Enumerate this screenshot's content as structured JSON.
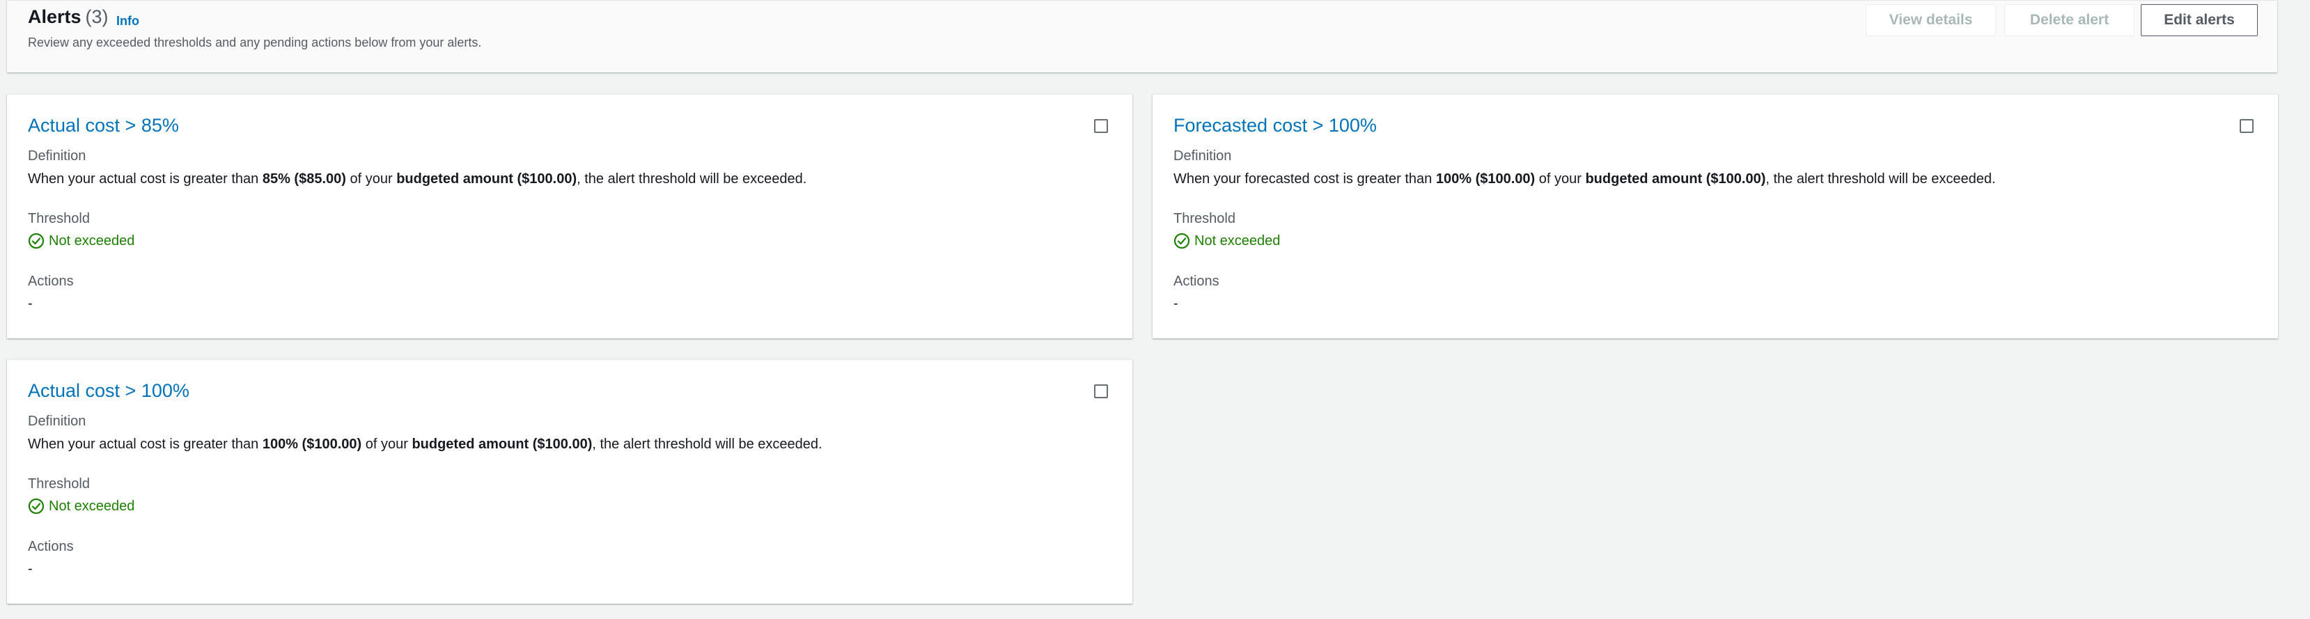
{
  "header": {
    "title": "Alerts",
    "count": "(3)",
    "info": "Info",
    "description": "Review any exceeded thresholds and any pending actions below from your alerts.",
    "buttons": {
      "view_details": "View details",
      "delete_alert": "Delete alert",
      "edit_alerts": "Edit alerts"
    }
  },
  "labels": {
    "definition": "Definition",
    "threshold": "Threshold",
    "actions": "Actions"
  },
  "alerts": [
    {
      "title": "Actual cost > 85%",
      "def_pre": "When your actual cost is greater than ",
      "def_pct": "85% ($85.00)",
      "def_mid": " of your ",
      "def_amount": "budgeted amount ($100.00)",
      "def_post": ", the alert threshold will be exceeded.",
      "threshold_status": "Not exceeded",
      "actions": "-"
    },
    {
      "title": "Forecasted cost > 100%",
      "def_pre": "When your forecasted cost is greater than ",
      "def_pct": "100% ($100.00)",
      "def_mid": " of your ",
      "def_amount": "budgeted amount ($100.00)",
      "def_post": ", the alert threshold will be exceeded.",
      "threshold_status": "Not exceeded",
      "actions": "-"
    },
    {
      "title": "Actual cost > 100%",
      "def_pre": "When your actual cost is greater than ",
      "def_pct": "100% ($100.00)",
      "def_mid": " of your ",
      "def_amount": "budgeted amount ($100.00)",
      "def_post": ", the alert threshold will be exceeded.",
      "threshold_status": "Not exceeded",
      "actions": "-"
    }
  ],
  "colors": {
    "link": "#0073bb",
    "success": "#1d8102",
    "background": "#f2f3f3"
  }
}
